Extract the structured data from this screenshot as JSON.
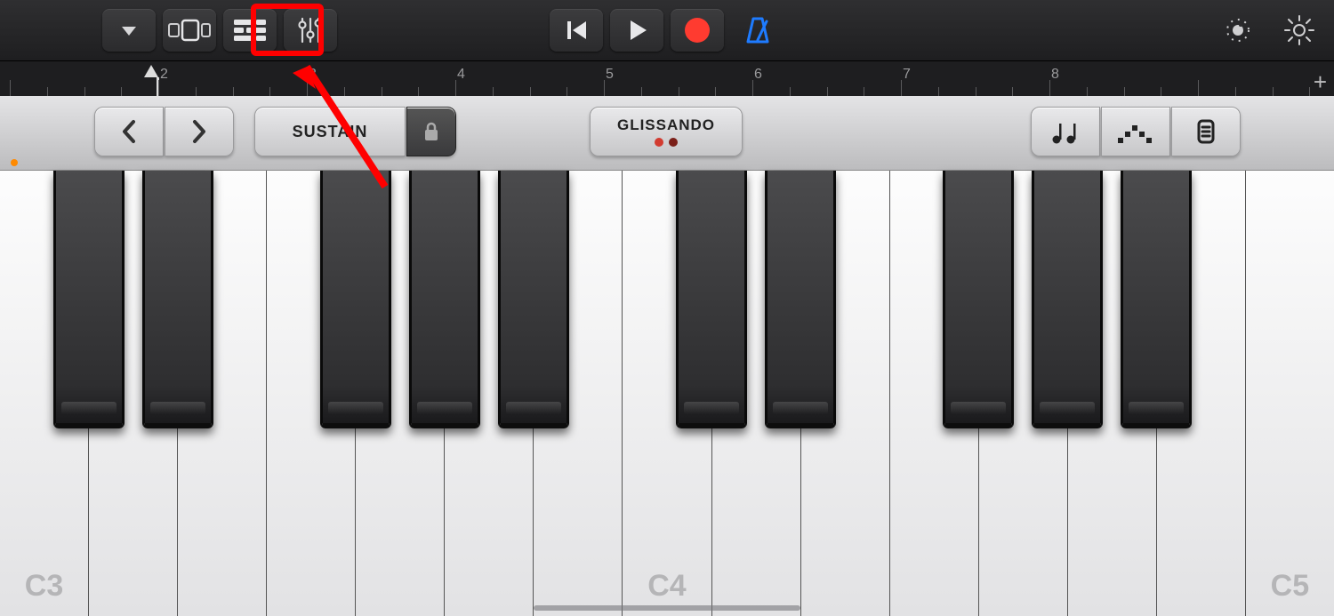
{
  "toolbar": {
    "instrument_browser_icon": "triangle-down-icon",
    "view_toggle_icon": "view-toggle-icon",
    "tracks_view_icon": "tracks-view-icon",
    "mixer_icon": "mixer-sliders-icon",
    "go_to_start_icon": "skip-back-icon",
    "play_icon": "play-icon",
    "record_icon": "record-icon",
    "metronome_icon": "metronome-icon",
    "loop_icon": "loop-dial-icon",
    "settings_icon": "gear-icon",
    "highlight_target": "tracks-view-button"
  },
  "ruler": {
    "bars": [
      "2",
      "3",
      "4",
      "5",
      "6",
      "7",
      "8"
    ],
    "add_label": "+"
  },
  "controls": {
    "octave_prev_icon": "chevron-left-icon",
    "octave_next_icon": "chevron-right-icon",
    "sustain_label": "SUSTAIN",
    "sustain_lock_icon": "lock-icon",
    "glissando_label": "GLISSANDO",
    "glissando_indicator_colors": [
      "#d23b30",
      "#7a1f18"
    ],
    "arpeggiator_icon": "arpeggiator-notes-icon",
    "scale_icon": "scale-dots-icon",
    "keyboard_layout_icon": "keyboard-layout-icon"
  },
  "piano": {
    "white_key_count": 15,
    "labels": {
      "0": "C3",
      "7": "C4",
      "14": "C5"
    },
    "black_key_pattern": [
      0,
      1,
      3,
      4,
      5,
      7,
      8,
      10,
      11,
      12
    ]
  }
}
